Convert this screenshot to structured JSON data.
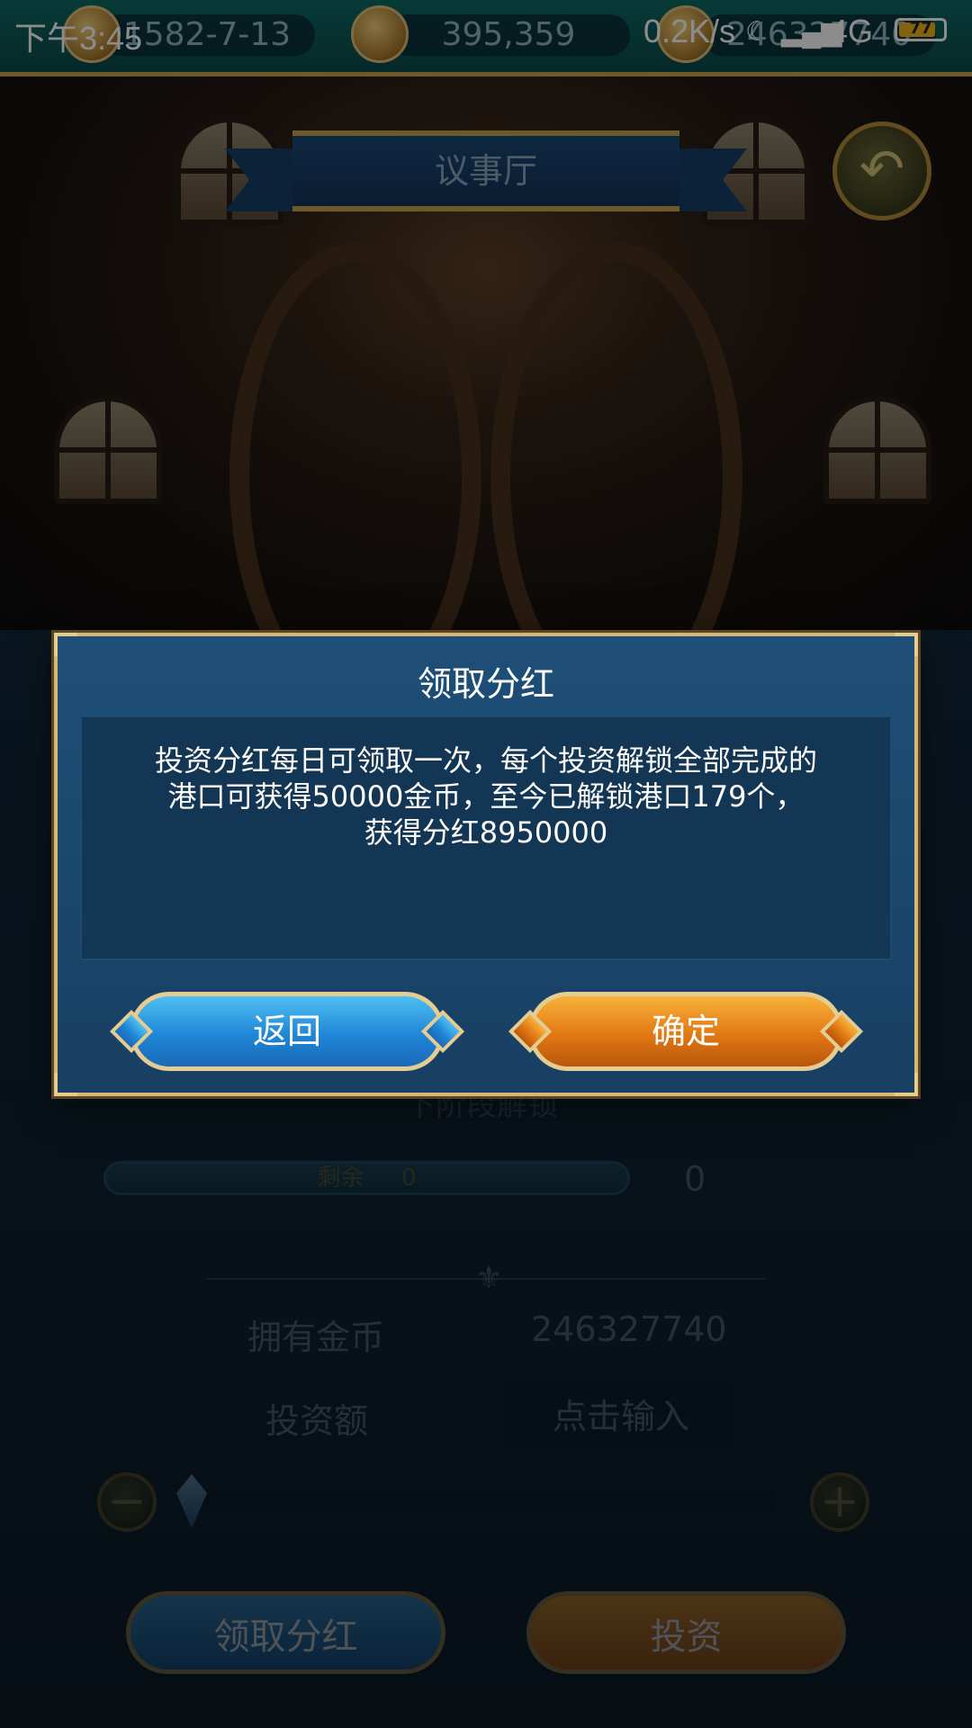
{
  "status_bar": {
    "time": "下午3:45",
    "network_speed": "0.2K/s",
    "network_type": "4G",
    "battery": "77"
  },
  "hud": {
    "date": "1582-7-13",
    "reputation": "395,359",
    "gold": "246327740"
  },
  "screen": {
    "title": "议事厅",
    "back_icon": "back-arrow-icon"
  },
  "panel": {
    "stage_label": "下阶段解锁",
    "remaining_label": "剩余",
    "remaining_value": "0",
    "progress_value": "0",
    "owned_gold_label": "拥有金币",
    "owned_gold_value": "246327740",
    "invest_amount_label": "投资额",
    "invest_amount_placeholder": "点击输入",
    "collect_dividend_button": "领取分红",
    "invest_button": "投资"
  },
  "dialog": {
    "title": "领取分红",
    "message": "投资分红每日可领取一次，每个投资解锁全部完成的港口可获得50000金币，至今已解锁港口179个，获得分红8950000",
    "back_button": "返回",
    "confirm_button": "确定"
  },
  "colors": {
    "accent_gold": "#d6b873",
    "dialog_bg": "#1e4f78",
    "blue_button": "#1f86d6",
    "orange_button": "#e27812"
  }
}
